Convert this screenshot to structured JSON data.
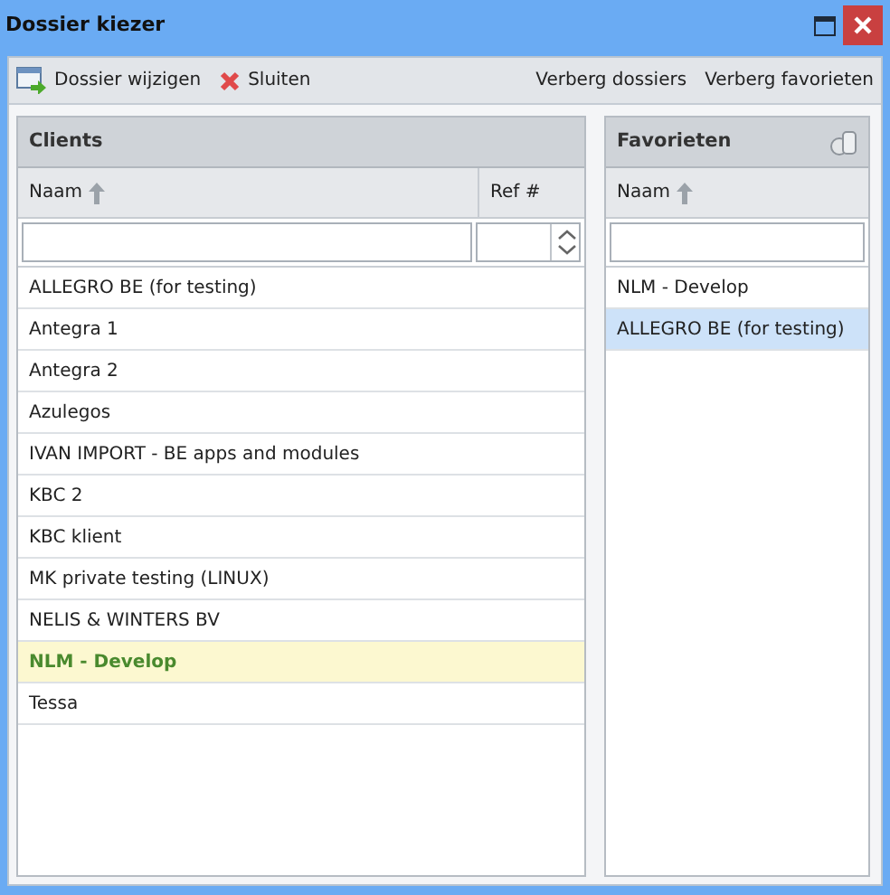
{
  "window": {
    "title": "Dossier kiezer"
  },
  "toolbar": {
    "left": [
      {
        "label": "Dossier wijzigen",
        "kind": "change"
      },
      {
        "label": "Sluiten",
        "kind": "close"
      }
    ],
    "right": [
      "Verberg dossiers",
      "Verberg favorieten"
    ]
  },
  "clients": {
    "title": "Clients",
    "columns": [
      {
        "label": "Naam",
        "sorted": true
      },
      {
        "label": "Ref #",
        "sorted": false
      }
    ],
    "rows": [
      {
        "name": "ALLEGRO BE (for testing)",
        "selected": false
      },
      {
        "name": "Antegra 1",
        "selected": false
      },
      {
        "name": "Antegra 2",
        "selected": false
      },
      {
        "name": "Azulegos",
        "selected": false
      },
      {
        "name": "IVAN IMPORT - BE apps and modules",
        "selected": false
      },
      {
        "name": "KBC 2",
        "selected": false
      },
      {
        "name": "KBC klient",
        "selected": false
      },
      {
        "name": "MK private testing (LINUX)",
        "selected": false
      },
      {
        "name": "NELIS & WINTERS BV",
        "selected": false
      },
      {
        "name": "NLM - Develop",
        "selected": true
      },
      {
        "name": "Tessa",
        "selected": false
      }
    ]
  },
  "favorites": {
    "title": "Favorieten",
    "columns": [
      {
        "label": "Naam",
        "sorted": true
      }
    ],
    "rows": [
      {
        "name": "NLM - Develop",
        "selected": false
      },
      {
        "name": "ALLEGRO BE (for testing)",
        "selected": true
      }
    ]
  }
}
